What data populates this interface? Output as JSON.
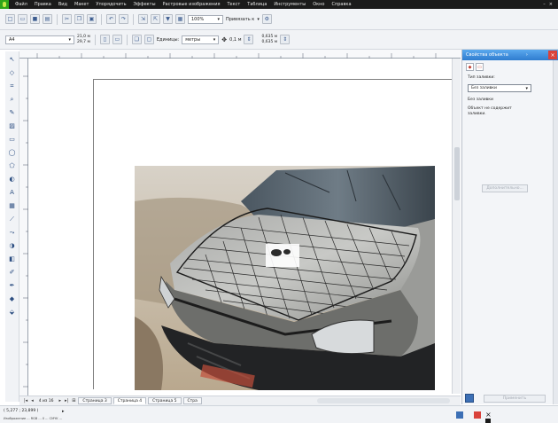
{
  "menubar": {
    "items": [
      "Файл",
      "Правка",
      "Вид",
      "Макет",
      "Упорядочить",
      "Эффекты",
      "Растровые изображения",
      "Текст",
      "Таблица",
      "Инструменты",
      "Окно",
      "Справка"
    ]
  },
  "toolbar": {
    "zoom_value": "100%",
    "snap_label": "Привязать к",
    "page_size": "A4",
    "width_value": "21,0 м",
    "height_value": "29,7 м",
    "units_label": "Единицы:",
    "units_value": "метры",
    "nudge_value": "0,1 м",
    "dup_x": "0,635 м",
    "dup_y": "0,635 м"
  },
  "panel": {
    "title": "Свойства объекта",
    "fill_type_label": "Тип заливки:",
    "fill_type_value": "Без заливки",
    "fill_name": "Без заливки",
    "fill_desc": "Объект не содержит заливки.",
    "more_button": "Дополнительно...",
    "apply_button": "Применить"
  },
  "pagebar": {
    "counter": "4 из 16",
    "tabs": [
      "Страница 3",
      "Страница 4",
      "Страница 5",
      "Стра"
    ]
  },
  "status": {
    "coords": "( 5,277 ; 23,899 )",
    "info": "Изображение ... RGB ... 0 ... CMYK ..."
  },
  "colors": {
    "menubar": "#1b1b1b",
    "panel_header": "#3b8ad9",
    "accent_green": "#2fa51a"
  }
}
